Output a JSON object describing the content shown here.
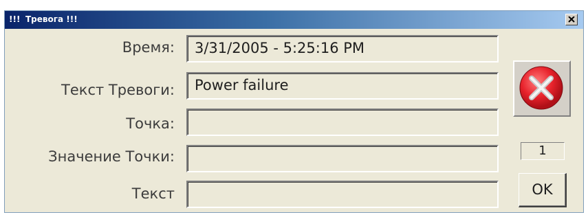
{
  "window": {
    "title_icon": "!!!",
    "title": "Тревога !!!",
    "close_icon": "close-icon"
  },
  "fields": {
    "time": {
      "label": "Время:",
      "value": "3/31/2005 - 5:25:16 PM"
    },
    "alarm_text": {
      "label": "Текст Тревоги:",
      "value": "Power failure"
    },
    "point": {
      "label": "Точка:",
      "value": ""
    },
    "point_value": {
      "label": "Значение Точки:",
      "value": ""
    },
    "text": {
      "label": "Текст",
      "value": ""
    }
  },
  "side": {
    "alarm_icon": "error-x-icon",
    "counter": "1",
    "ok_label": "OK"
  },
  "colors": {
    "titlebar_start": "#0a246a",
    "titlebar_end": "#a6caf0",
    "window_bg": "#ece9d8",
    "alarm_red": "#e8232c"
  }
}
